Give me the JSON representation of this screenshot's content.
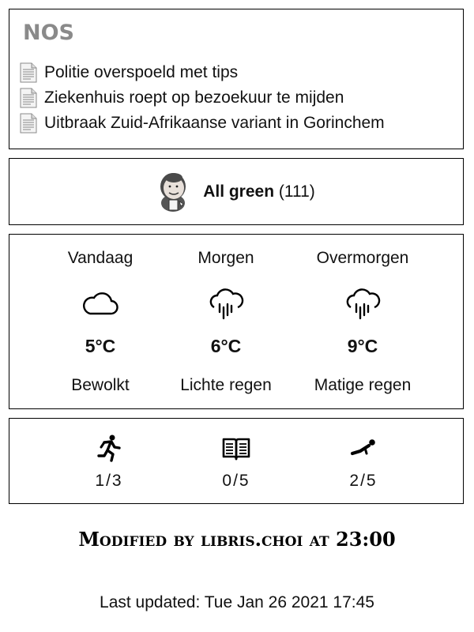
{
  "news": {
    "source": "NOS",
    "items": [
      {
        "icon": "document-icon",
        "title": "Politie overspoeld met tips"
      },
      {
        "icon": "document-icon",
        "title": "Ziekenhuis roept op bezoekuur te mijden"
      },
      {
        "icon": "document-icon",
        "title": "Uitbraak Zuid-Afrikaanse variant in Gorinchem"
      }
    ]
  },
  "jenkins": {
    "icon": "jenkins-icon",
    "status": "All green",
    "count": "(111)"
  },
  "weather": {
    "days": [
      {
        "day": "Vandaag",
        "icon": "cloud-icon",
        "temp": "5°C",
        "desc": "Bewolkt"
      },
      {
        "day": "Morgen",
        "icon": "rain-cloud-icon",
        "temp": "6°C",
        "desc": "Lichte regen"
      },
      {
        "day": "Overmorgen",
        "icon": "rain-cloud-icon",
        "temp": "9°C",
        "desc": "Matige regen"
      }
    ]
  },
  "activities": [
    {
      "icon": "running-icon",
      "value": "1/3"
    },
    {
      "icon": "book-icon",
      "value": "0/5"
    },
    {
      "icon": "pushup-icon",
      "value": "2/5"
    }
  ],
  "footer": {
    "modified": "Modified by libris.choi at 23:00",
    "updated": "Last updated: Tue Jan 26 2021 17:45"
  }
}
